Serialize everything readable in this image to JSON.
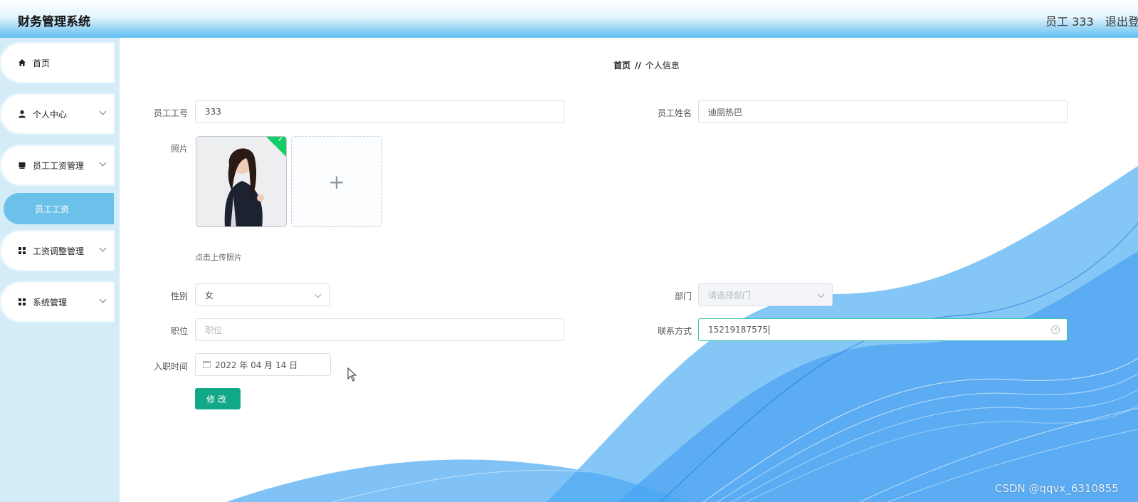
{
  "header": {
    "app_title": "财务管理系统",
    "user_label": "员工 333",
    "logout_label": "退出登"
  },
  "sidebar": {
    "items": [
      {
        "label": "首页",
        "icon": "home-icon"
      },
      {
        "label": "个人中心",
        "icon": "user-icon"
      },
      {
        "label": "员工工资管理",
        "icon": "folder-icon"
      },
      {
        "label": "工资调整管理",
        "icon": "grid-icon"
      },
      {
        "label": "系统管理",
        "icon": "grid-icon"
      }
    ],
    "active_subitem": "员工工资"
  },
  "breadcrumb": {
    "home": "首页",
    "separator": "//",
    "current": "个人信息"
  },
  "form": {
    "employee_id": {
      "label": "员工工号",
      "value": "333"
    },
    "employee_name": {
      "label": "员工姓名",
      "value": "迪丽热巴"
    },
    "photo": {
      "label": "照片",
      "upload_hint": "点击上传照片",
      "plus": "+",
      "check": "✓"
    },
    "gender": {
      "label": "性别",
      "value": "女"
    },
    "department": {
      "label": "部门",
      "placeholder": "请选择部门"
    },
    "position": {
      "label": "职位",
      "placeholder": "职位"
    },
    "contact": {
      "label": "联系方式",
      "value": "15219187575"
    },
    "hire_date": {
      "label": "入职时间",
      "value": "2022 年 04 月 14 日"
    },
    "submit_label": "修改"
  },
  "watermark": "CSDN @qqvx_6310855",
  "colors": {
    "topbar_gradient_end": "#5ebdf0",
    "sidebar_bg": "#d4ecf7",
    "active_menu": "#6cc1ea",
    "submit_button": "#11a887",
    "focus_border": "#3cc6a8",
    "wave_blue": "#2d8ef0"
  }
}
